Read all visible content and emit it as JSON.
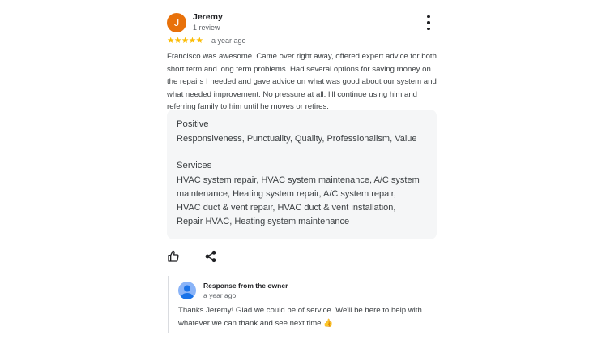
{
  "review": {
    "avatar_letter": "J",
    "avatar_color": "#e8710a",
    "reviewer_name": "Jeremy",
    "review_count": "1 review",
    "more_icon": "more-vert-icon",
    "rating": 5,
    "stars": "★★★★★",
    "star_color": "#fbbc04",
    "date": "a year ago",
    "text": "Francisco was awesome. Came over right away, offered expert advice for both short term and long term problems. Had several options for saving money on the repairs I needed and gave advice on what was good about our system and what needed improvement. No pressure at all. I'll continue using him and referring family to him until he moves or retires."
  },
  "attributes": {
    "positive_title": "Positive",
    "positive_values": "Responsiveness, Punctuality, Quality, Professionalism, Value",
    "services_title": "Services",
    "services_values": "HVAC system repair, HVAC system maintenance, A/C system maintenance, Heating system repair, A/C system repair, HVAC duct & vent repair, HVAC duct & vent installation, Repair HVAC, Heating system maintenance"
  },
  "actions": {
    "like_icon": "thumbs-up-icon",
    "share_icon": "share-icon"
  },
  "owner_response": {
    "title": "Response from the owner",
    "date": "a year ago",
    "text": "Thanks Jeremy! Glad we could be of service. We'll be here to help with whatever we can thank and see next time",
    "emoji": "👍"
  }
}
